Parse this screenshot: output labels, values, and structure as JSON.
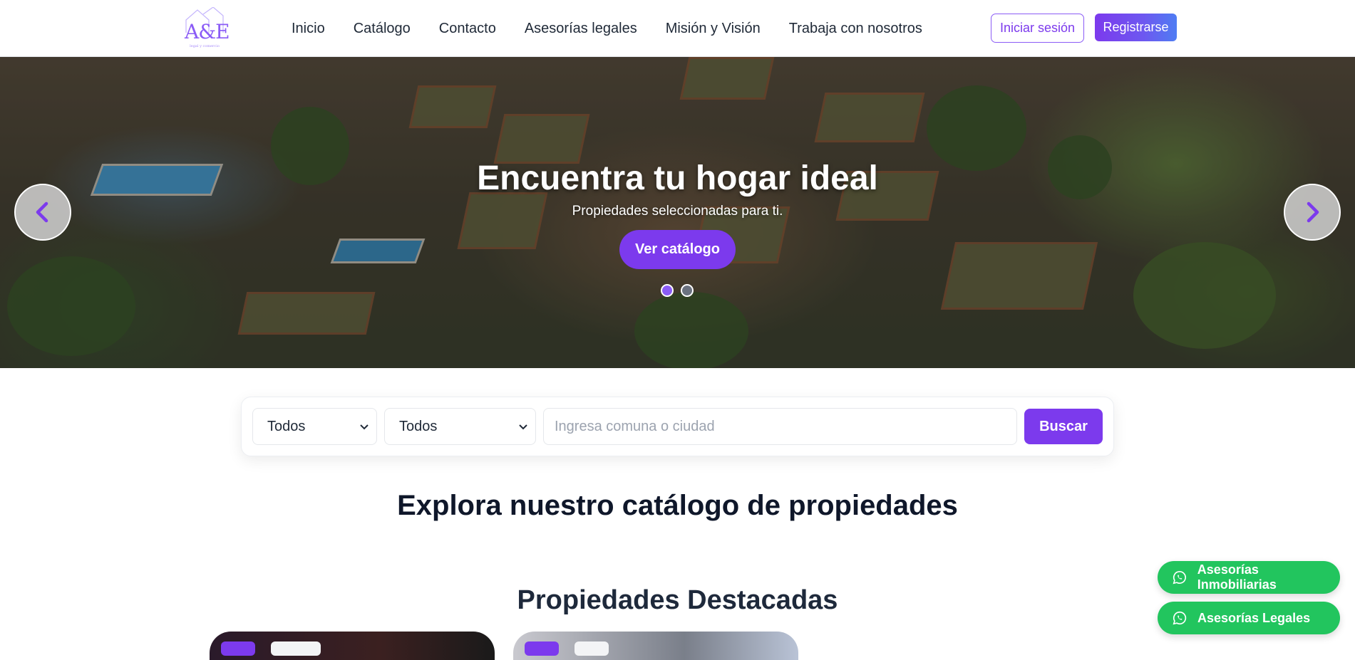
{
  "brand": {
    "logo_text": "A&E",
    "logo_subtitle": "legal y comercio"
  },
  "nav": {
    "links": [
      "Inicio",
      "Catálogo",
      "Contacto",
      "Asesorías legales",
      "Misión y Visión",
      "Trabaja con nosotros"
    ],
    "login_label": "Iniciar sesión",
    "register_label": "Registrarse"
  },
  "hero": {
    "title": "Encuentra tu hogar ideal",
    "subtitle": "Propiedades seleccionadas para ti.",
    "cta_label": "Ver catálogo",
    "slides_total": 2,
    "active_slide": 1
  },
  "search": {
    "type_select_value": "Todos",
    "operation_select_value": "Todos",
    "location_placeholder": "Ingresa comuna o ciudad",
    "button_label": "Buscar"
  },
  "sections": {
    "catalog_heading": "Explora nuestro catálogo de propiedades",
    "featured_heading": "Propiedades Destacadas"
  },
  "floating": {
    "real_estate_label": "Asesorías Inmobiliarias",
    "legal_label": "Asesorías Legales",
    "icon": "whatsapp-icon"
  },
  "colors": {
    "accent": "#7c3aed",
    "whatsapp": "#22c55e",
    "heading": "#0f172a"
  }
}
